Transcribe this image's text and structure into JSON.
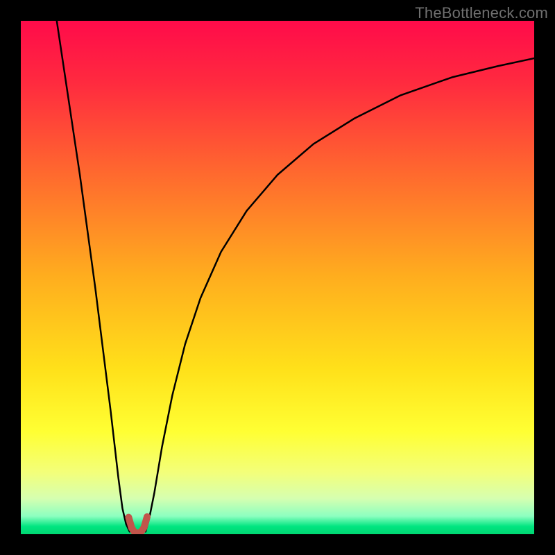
{
  "watermark": "TheBottleneck.com",
  "chart_data": {
    "type": "line",
    "title": "",
    "xlabel": "",
    "ylabel": "",
    "xlim": [
      0,
      100
    ],
    "ylim": [
      0,
      100
    ],
    "grid": false,
    "legend_position": "none",
    "gradient_stops": [
      {
        "offset": 0.0,
        "color": "#ff0b4a"
      },
      {
        "offset": 0.12,
        "color": "#ff2a3f"
      },
      {
        "offset": 0.3,
        "color": "#ff6a2e"
      },
      {
        "offset": 0.5,
        "color": "#ffae1e"
      },
      {
        "offset": 0.68,
        "color": "#ffe11a"
      },
      {
        "offset": 0.8,
        "color": "#ffff33"
      },
      {
        "offset": 0.88,
        "color": "#f3ff7a"
      },
      {
        "offset": 0.93,
        "color": "#d6ffb0"
      },
      {
        "offset": 0.965,
        "color": "#8cffc0"
      },
      {
        "offset": 0.985,
        "color": "#00e580"
      },
      {
        "offset": 1.0,
        "color": "#00d772"
      }
    ],
    "series": [
      {
        "name": "left-branch",
        "stroke": "#000000",
        "width": 2.5,
        "x": [
          7.0,
          8.5,
          10.0,
          11.5,
          13.0,
          14.5,
          16.0,
          17.5,
          19.0,
          19.8,
          20.5,
          21.2
        ],
        "y": [
          100.0,
          90.0,
          80.0,
          70.0,
          59.0,
          48.0,
          36.0,
          24.0,
          11.0,
          5.0,
          2.0,
          0.5
        ]
      },
      {
        "name": "right-branch",
        "stroke": "#000000",
        "width": 2.5,
        "x": [
          24.3,
          25.0,
          26.0,
          27.5,
          29.5,
          32.0,
          35.0,
          39.0,
          44.0,
          50.0,
          57.0,
          65.0,
          74.0,
          84.0,
          93.0,
          100.0
        ],
        "y": [
          0.5,
          3.0,
          8.0,
          17.0,
          27.0,
          37.0,
          46.0,
          55.0,
          63.0,
          70.0,
          76.0,
          81.0,
          85.5,
          89.0,
          91.2,
          92.7
        ]
      },
      {
        "name": "valley-marker",
        "stroke": "#c1554b",
        "width": 10,
        "x": [
          21.0,
          21.6,
          22.2,
          22.8,
          23.4,
          24.0,
          24.6
        ],
        "y": [
          3.3,
          1.2,
          0.3,
          0.2,
          0.4,
          1.3,
          3.4
        ]
      }
    ]
  }
}
